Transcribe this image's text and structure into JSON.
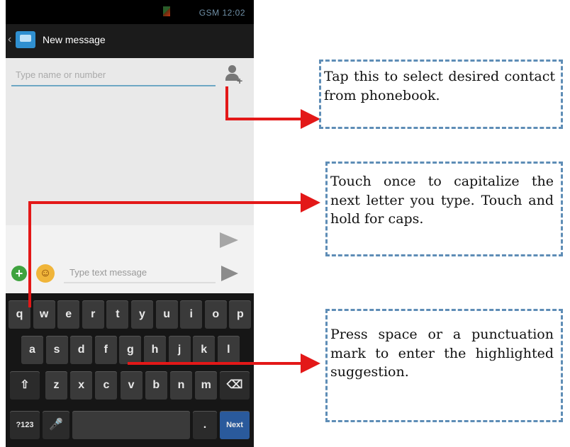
{
  "status_bar": {
    "time": "12:02",
    "network": "GSM"
  },
  "action_bar": {
    "title": "New message"
  },
  "recipient": {
    "placeholder": "Type name or number"
  },
  "compose": {
    "placeholder": "Type text message"
  },
  "keyboard": {
    "row1": [
      "q",
      "w",
      "e",
      "r",
      "t",
      "y",
      "u",
      "i",
      "o",
      "p"
    ],
    "row2": [
      "a",
      "s",
      "d",
      "f",
      "g",
      "h",
      "j",
      "k",
      "l"
    ],
    "row3": [
      "z",
      "x",
      "c",
      "v",
      "b",
      "n",
      "m"
    ],
    "shift_label": "⇧",
    "delete_label": "⌫",
    "symbols_label": "?123",
    "period_label": ".",
    "next_label": "Next"
  },
  "callouts": {
    "contact": "Tap this to select desired contact from phonebook.",
    "capitalize": "Touch once to capitalize the next letter you type. Touch and hold for caps.",
    "suggestion": "Press space or a punctuation mark to enter the highlighted suggestion."
  },
  "colors": {
    "arrow": "#e31818",
    "dash_border": "#5e8db6",
    "next_key": "#2a5a9c"
  }
}
